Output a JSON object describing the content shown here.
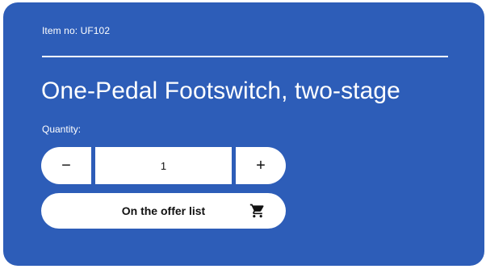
{
  "colors": {
    "card_background": "#2d5db8",
    "button_background": "#ffffff",
    "button_text": "#111111"
  },
  "product": {
    "item_number_text": "Item no: UF102",
    "title": "One-Pedal Footswitch, two-stage"
  },
  "quantity": {
    "label": "Quantity:",
    "value": "1",
    "decrement_label": "−",
    "increment_label": "+"
  },
  "offer_button": {
    "label": "On the offer list",
    "icon": "shopping-cart-icon"
  }
}
